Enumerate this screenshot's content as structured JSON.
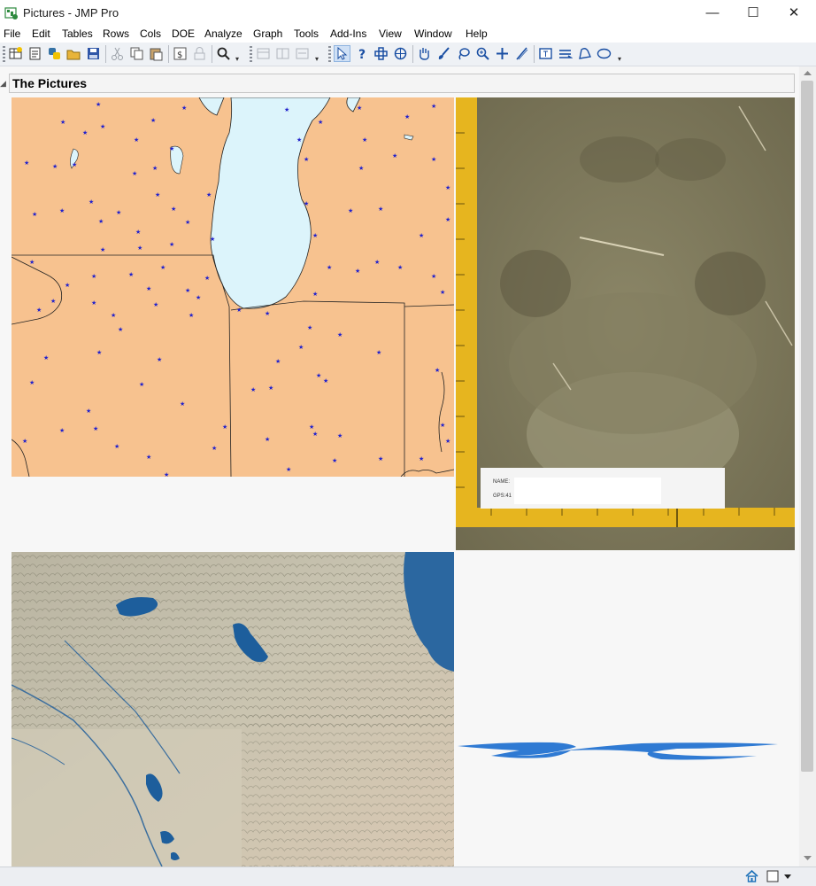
{
  "window": {
    "title": "Pictures - JMP Pro",
    "minimize_glyph": "—",
    "maximize_glyph": "☐",
    "close_glyph": "✕"
  },
  "menu": [
    "File",
    "Edit",
    "Tables",
    "Rows",
    "Cols",
    "DOE",
    "Analyze",
    "Graph",
    "Tools",
    "Add-Ins",
    "View",
    "Window",
    "Help"
  ],
  "toolbar": {
    "icons": [
      "new-data-table-icon",
      "new-script-icon",
      "python-icon",
      "open-icon",
      "save-icon",
      "cut-icon",
      "copy-icon",
      "paste-icon",
      "journal-icon",
      "lock-icon",
      "search-icon",
      "arrow-tool-icon",
      "help-tool-icon",
      "crosshair-tool-icon",
      "grabber-tool-icon",
      "hand-tool-icon",
      "brush-tool-icon",
      "lasso-tool-icon",
      "magnifier-tool-icon",
      "plus-tool-icon",
      "line-tool-icon",
      "annotate-tool-icon",
      "simple-shape-icon",
      "polygon-tool-icon",
      "oval-tool-icon"
    ]
  },
  "report": {
    "title": "The Pictures"
  },
  "pictures": [
    {
      "name": "midwest-map",
      "description_icon": "map-picture"
    },
    {
      "name": "bear-footprint",
      "ruler_label_name": "NAME:",
      "ruler_label_gps": "GPS:41"
    },
    {
      "name": "relief-map"
    },
    {
      "name": "blue-brushstroke"
    }
  ],
  "colors": {
    "map_land": "#f7c28f",
    "lake": "#dcf4fb",
    "star": "#2222cc",
    "ruler": "#e6b51f",
    "soil": "#7a7459",
    "brush": "#1d6fcf"
  }
}
